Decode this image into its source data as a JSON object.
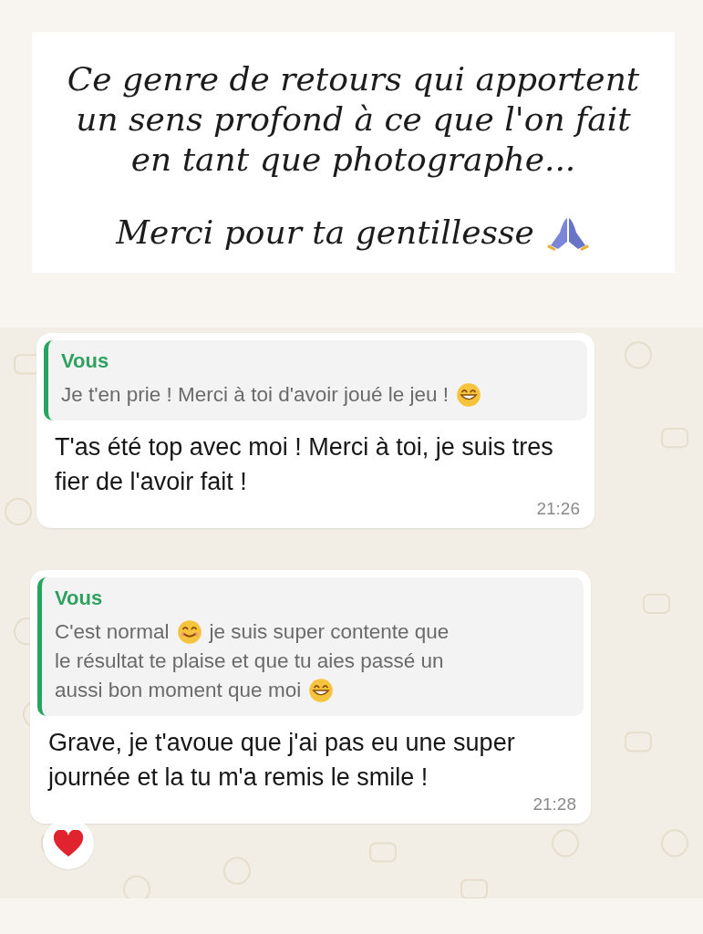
{
  "caption": {
    "lines": [
      "Ce genre de retours qui apportent",
      "un sens profond à ce que l'on fait",
      "en tant que photographe..."
    ],
    "closing": "Merci pour ta gentillesse",
    "closing_icon": {
      "kind": "pray"
    }
  },
  "messages": [
    {
      "quote": {
        "author": "Vous",
        "lines": [
          [
            {
              "kind": "text",
              "text": "Je t'en prie ! Merci à toi d'avoir joué le jeu !"
            },
            {
              "kind": "grin"
            }
          ]
        ]
      },
      "text": "T'as été top avec moi ! Merci à toi, je suis tres fier de l'avoir fait !",
      "time": "21:26"
    },
    {
      "quote": {
        "author": "Vous",
        "lines": [
          [
            {
              "kind": "text",
              "text": "C'est normal"
            },
            {
              "kind": "smile"
            },
            {
              "kind": "text",
              "text": "je suis super contente que"
            }
          ],
          [
            {
              "kind": "text",
              "text": "le résultat te plaise et que tu aies passé un"
            }
          ],
          [
            {
              "kind": "text",
              "text": "aussi bon moment que moi"
            },
            {
              "kind": "grin"
            }
          ]
        ]
      },
      "text": "Grave, je t'avoue que j'ai pas eu une super journée et la tu m'a remis le smile !",
      "time": "21:28",
      "reaction": {
        "kind": "heart"
      }
    }
  ]
}
